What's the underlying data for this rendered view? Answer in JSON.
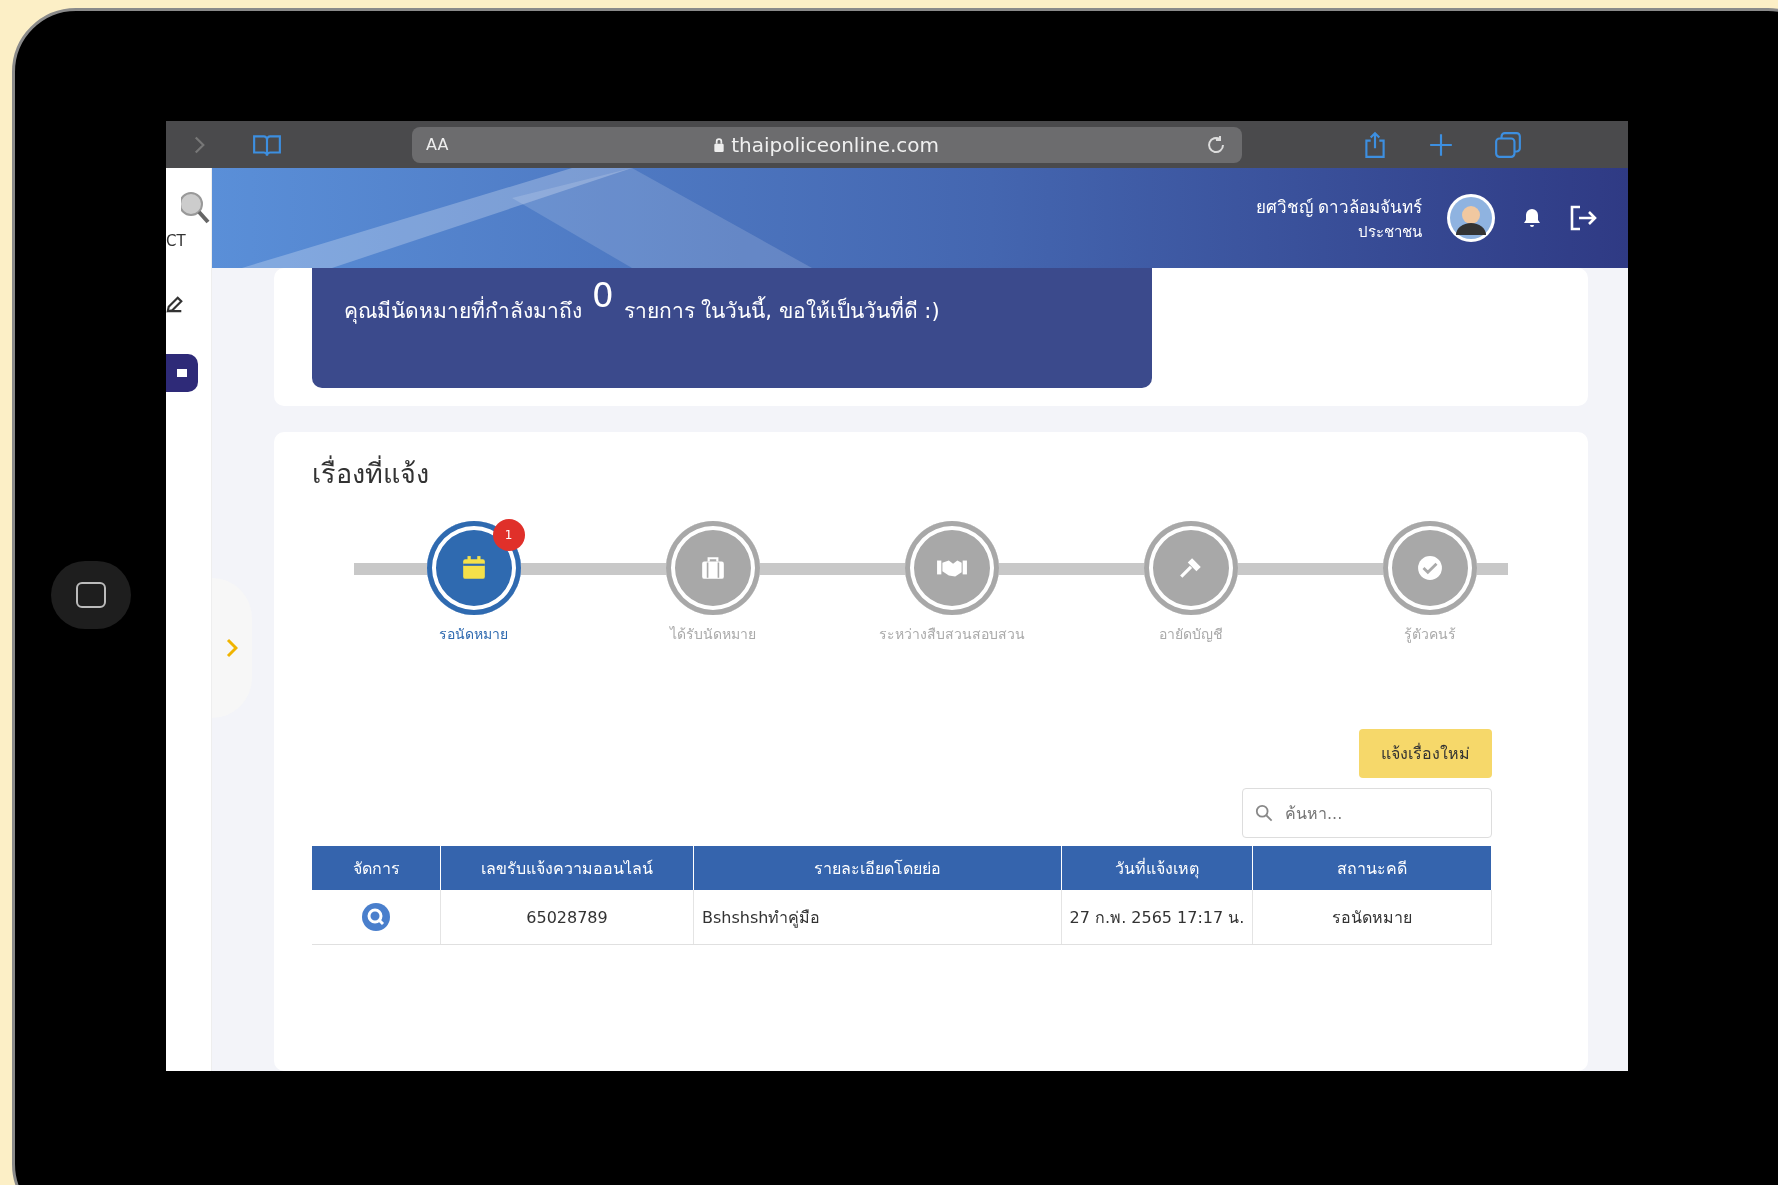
{
  "browser": {
    "text_size_button": "AA",
    "url": "thaipoliceonline.com"
  },
  "sidebar": {
    "logo_text": "CT"
  },
  "header": {
    "user_name": "ยศวิชญ์ ดาวล้อมจันทร์",
    "user_role": "ประชาชน"
  },
  "banner": {
    "prefix": "คุณมีนัดหมายที่กำลังมาถึง",
    "count": "0",
    "suffix": "รายการ ในวันนี้, ขอให้เป็นวันที่ดี :)"
  },
  "reports": {
    "title": "เรื่องที่แจ้ง",
    "steps": [
      {
        "label": "รอนัดหมาย",
        "kind": "calendar",
        "selected": true,
        "badge": "1"
      },
      {
        "label": "ได้รับนัดหมาย",
        "kind": "briefcase",
        "selected": false
      },
      {
        "label": "ระหว่างสืบสวนสอบสวน",
        "kind": "handshake",
        "selected": false
      },
      {
        "label": "อายัดบัญชี",
        "kind": "gavel",
        "selected": false
      },
      {
        "label": "รู้ตัวคนร้",
        "kind": "check",
        "selected": false
      }
    ],
    "new_button": "แจ้งเรื่องใหม่",
    "search": {
      "placeholder": "ค้นหา..."
    },
    "table": {
      "columns": [
        "จัดการ",
        "เลขรับแจ้งความออนไลน์",
        "รายละเอียดโดยย่อ",
        "วันที่แจ้งเหตุ",
        "สถานะคดี"
      ],
      "rows": [
        {
          "case_number": "65028789",
          "summary": "Bshshshทำคู่มือ",
          "date": "27 ก.พ. 2565 17:17 น.",
          "status": "รอนัดหมาย"
        }
      ]
    }
  }
}
